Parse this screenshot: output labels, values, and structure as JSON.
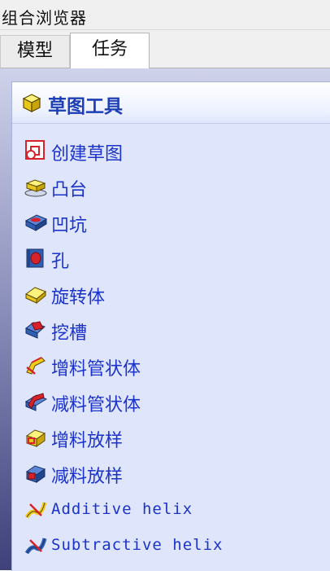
{
  "window": {
    "title": "组合浏览器"
  },
  "tabs": [
    {
      "label": "模型"
    },
    {
      "label": "任务"
    }
  ],
  "panel": {
    "title": "草图工具",
    "items": [
      {
        "label": "创建草图",
        "icon": "create-sketch-icon"
      },
      {
        "label": "凸台",
        "icon": "pad-icon"
      },
      {
        "label": "凹坑",
        "icon": "pocket-icon"
      },
      {
        "label": "孔",
        "icon": "hole-icon"
      },
      {
        "label": "旋转体",
        "icon": "revolution-icon"
      },
      {
        "label": "挖槽",
        "icon": "groove-icon"
      },
      {
        "label": "增料管状体",
        "icon": "additive-pipe-icon"
      },
      {
        "label": "减料管状体",
        "icon": "subtractive-pipe-icon"
      },
      {
        "label": "增料放样",
        "icon": "additive-loft-icon"
      },
      {
        "label": "减料放样",
        "icon": "subtractive-loft-icon"
      },
      {
        "label": "Additive helix",
        "icon": "additive-helix-icon"
      },
      {
        "label": "Subtractive helix",
        "icon": "subtractive-helix-icon"
      }
    ]
  },
  "colors": {
    "accent_text": "#1c33c9",
    "header_text": "#1e3fb5",
    "panel_bg": "#dfe6fb",
    "yellow": "#f2cc1a",
    "red": "#d6222a",
    "blue": "#2d5fb5"
  }
}
